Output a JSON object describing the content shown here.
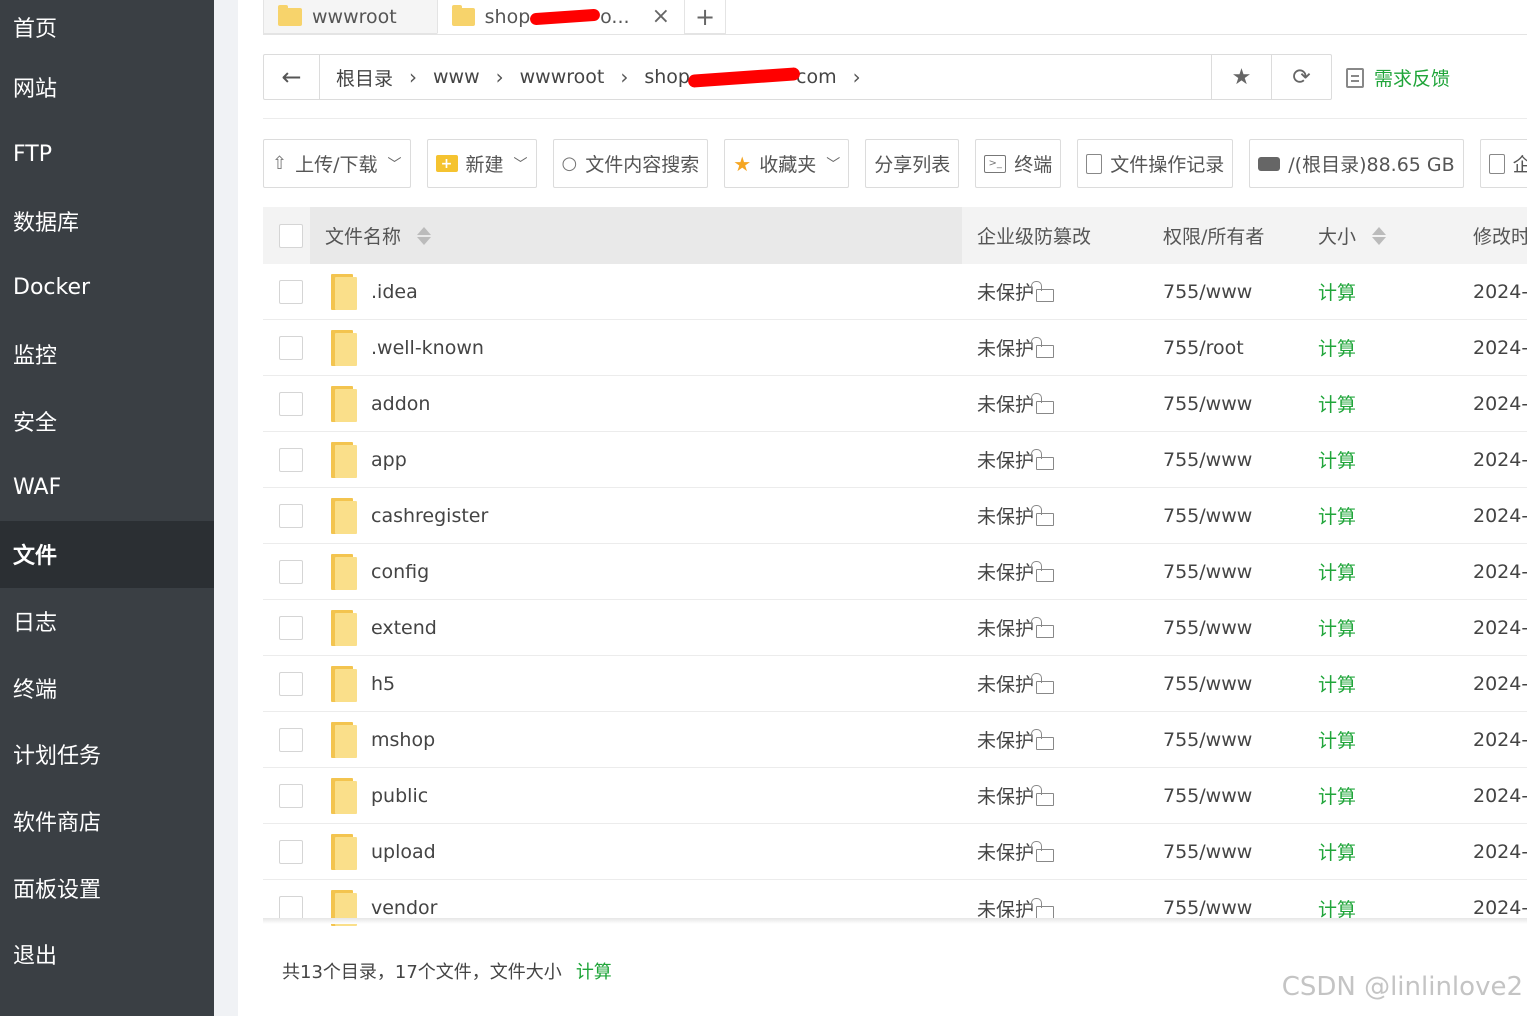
{
  "sidebar": {
    "items": [
      {
        "label": "首页"
      },
      {
        "label": "网站"
      },
      {
        "label": "FTP"
      },
      {
        "label": "数据库"
      },
      {
        "label": "Docker"
      },
      {
        "label": "监控"
      },
      {
        "label": "安全"
      },
      {
        "label": "WAF"
      },
      {
        "label": "文件",
        "active": true
      },
      {
        "label": "日志"
      },
      {
        "label": "终端"
      },
      {
        "label": "计划任务"
      },
      {
        "label": "软件商店"
      },
      {
        "label": "面板设置"
      },
      {
        "label": "退出"
      }
    ]
  },
  "tabs": {
    "tab1": "wwwroot",
    "tab2_prefix": "shop.",
    "tab2_suffix": "o...",
    "close": "×",
    "add": "+"
  },
  "breadcrumb": {
    "back": "←",
    "items": [
      "根目录",
      "www",
      "wwwroot"
    ],
    "last_prefix": "shop.",
    "last_suffix": "com",
    "sep": "›",
    "star": "★",
    "refresh": "⟳"
  },
  "feedback": {
    "label": "需求反馈"
  },
  "toolbar": {
    "upload": "上传/下载",
    "new": "新建",
    "search": "文件内容搜索",
    "favorites": "收藏夹",
    "share": "分享列表",
    "terminal": "终端",
    "oplog": "文件操作记录",
    "disk": "/(根目录)88.65 GB",
    "enterprise": "企业"
  },
  "table": {
    "headers": {
      "name": "文件名称",
      "protect": "企业级防篡改",
      "perm": "权限/所有者",
      "size": "大小",
      "modified": "修改时"
    },
    "rows": [
      {
        "name": ".idea",
        "protect": "未保护",
        "perm": "755/www",
        "size": "计算",
        "modified": "2024-"
      },
      {
        "name": ".well-known",
        "protect": "未保护",
        "perm": "755/root",
        "size": "计算",
        "modified": "2024-"
      },
      {
        "name": "addon",
        "protect": "未保护",
        "perm": "755/www",
        "size": "计算",
        "modified": "2024-"
      },
      {
        "name": "app",
        "protect": "未保护",
        "perm": "755/www",
        "size": "计算",
        "modified": "2024-"
      },
      {
        "name": "cashregister",
        "protect": "未保护",
        "perm": "755/www",
        "size": "计算",
        "modified": "2024-"
      },
      {
        "name": "config",
        "protect": "未保护",
        "perm": "755/www",
        "size": "计算",
        "modified": "2024-"
      },
      {
        "name": "extend",
        "protect": "未保护",
        "perm": "755/www",
        "size": "计算",
        "modified": "2024-"
      },
      {
        "name": "h5",
        "protect": "未保护",
        "perm": "755/www",
        "size": "计算",
        "modified": "2024-"
      },
      {
        "name": "mshop",
        "protect": "未保护",
        "perm": "755/www",
        "size": "计算",
        "modified": "2024-"
      },
      {
        "name": "public",
        "protect": "未保护",
        "perm": "755/www",
        "size": "计算",
        "modified": "2024-"
      },
      {
        "name": "upload",
        "protect": "未保护",
        "perm": "755/www",
        "size": "计算",
        "modified": "2024-"
      },
      {
        "name": "vendor",
        "protect": "未保护",
        "perm": "755/www",
        "size": "计算",
        "modified": "2024-"
      }
    ]
  },
  "footer": {
    "summary": "共13个目录，17个文件，文件大小",
    "calc": "计算"
  },
  "watermark": "CSDN @linlinlove2",
  "colors": {
    "sidebar_bg": "#3a3f44",
    "sidebar_active": "#2b2f33",
    "accent_green": "#20a53a",
    "folder_yellow": "#f3c44f"
  }
}
